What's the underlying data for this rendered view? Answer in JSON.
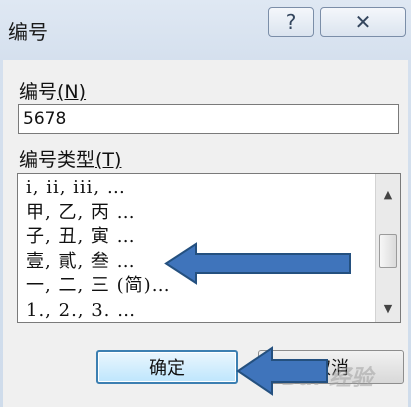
{
  "dialog": {
    "title": "编号",
    "help_label": "?",
    "close_label": "✕"
  },
  "number_field": {
    "label": "编号",
    "accesskey": "(N)",
    "value": "5678"
  },
  "type_list": {
    "label": "编号类型",
    "accesskey": "(T)",
    "items": [
      "i, ii, iii, …",
      "甲, 乙, 丙 …",
      "子, 丑, 寅 …",
      "壹, 貳, 叁 …",
      "一, 二, 三 (简)…",
      "1., 2., 3. …"
    ]
  },
  "buttons": {
    "ok": "确定",
    "cancel": "取消"
  },
  "watermark": "Bai 经验",
  "colors": {
    "arrow": "#3f74bb",
    "arrow_outline": "#24507f",
    "ok_border": "#3c7fb1"
  }
}
